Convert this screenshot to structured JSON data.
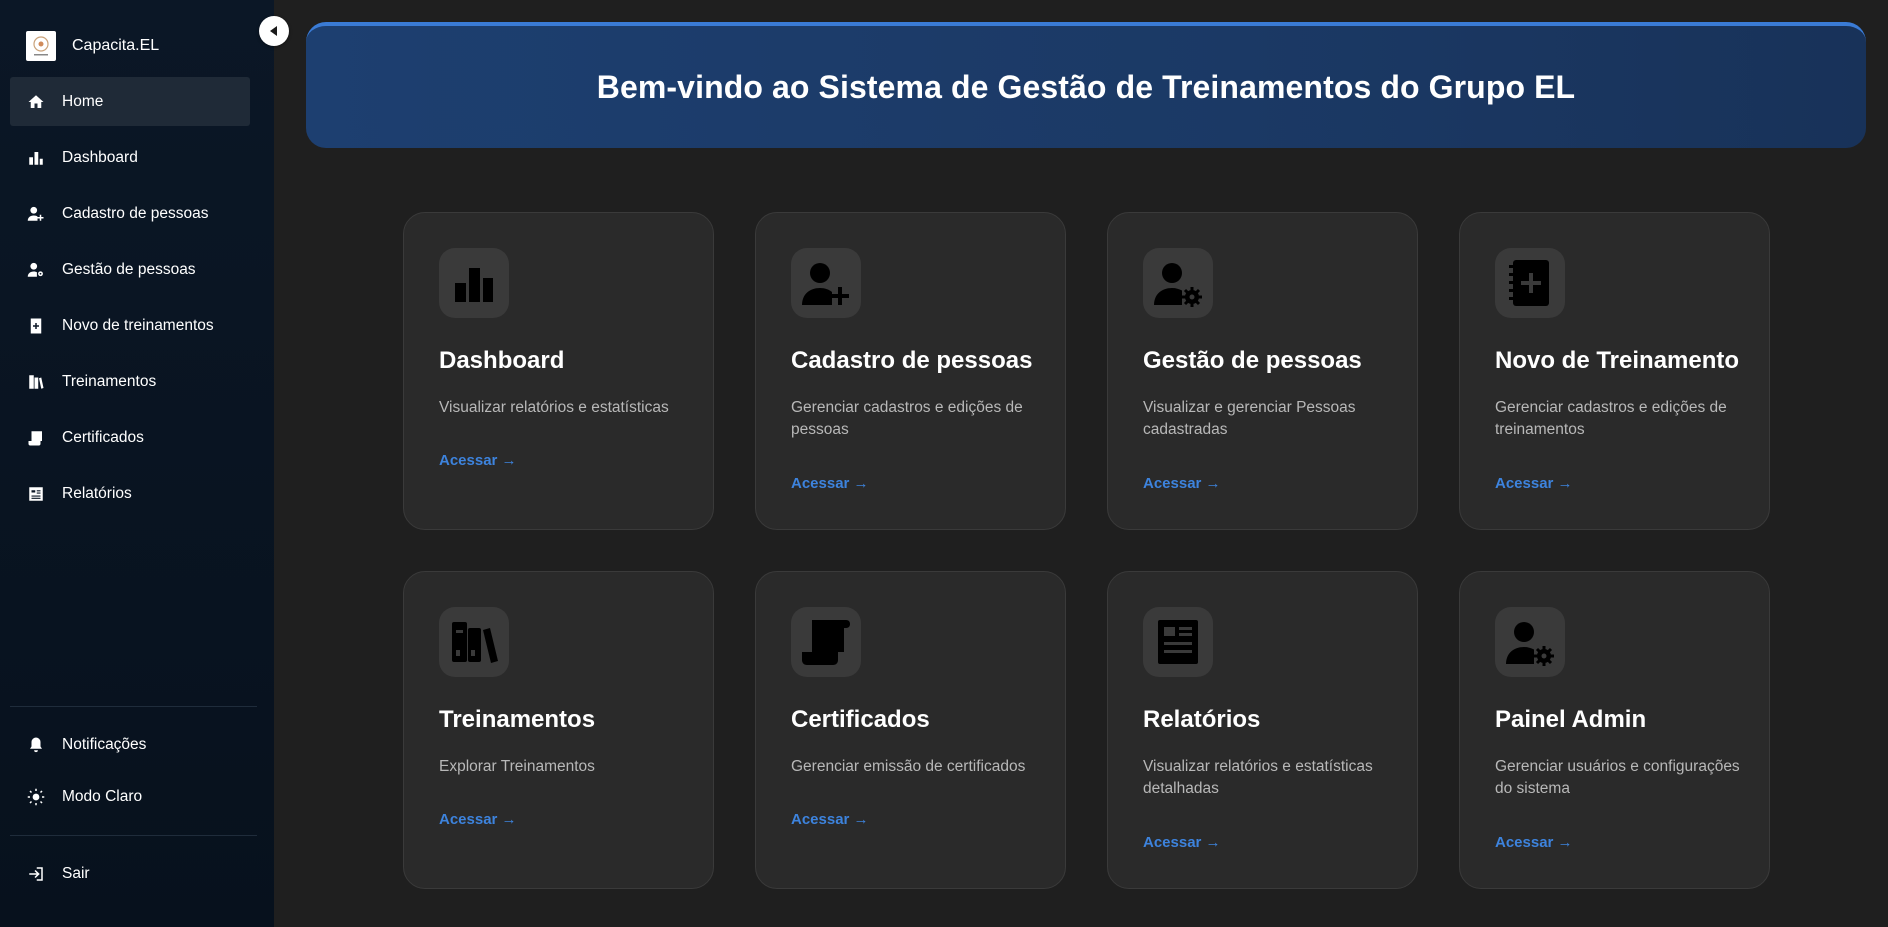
{
  "app": {
    "name": "Capacita.EL"
  },
  "sidebar": {
    "items": [
      {
        "label": "Home",
        "icon": "home-icon",
        "active": true
      },
      {
        "label": "Dashboard",
        "icon": "chart-icon"
      },
      {
        "label": "Cadastro de pessoas",
        "icon": "person-add-icon"
      },
      {
        "label": "Gestão de pessoas",
        "icon": "person-gear-icon"
      },
      {
        "label": "Novo de treinamentos",
        "icon": "notebook-plus-icon"
      },
      {
        "label": "Treinamentos",
        "icon": "books-icon"
      },
      {
        "label": "Certificados",
        "icon": "scroll-icon"
      },
      {
        "label": "Relatórios",
        "icon": "report-icon"
      }
    ],
    "notifications_label": "Notificações",
    "theme_label": "Modo Claro",
    "logout_label": "Sair"
  },
  "banner": {
    "title": "Bem-vindo ao Sistema de Gestão de Treinamentos do Grupo EL"
  },
  "cards": [
    {
      "title": "Dashboard",
      "desc": "Visualizar relatórios e estatísticas",
      "link": "Acessar →",
      "icon": "chart-icon"
    },
    {
      "title": "Cadastro de pessoas",
      "desc": "Gerenciar cadastros e edições de pessoas",
      "link": "Acessar →",
      "icon": "person-add-icon"
    },
    {
      "title": "Gestão de pessoas",
      "desc": "Visualizar e gerenciar Pessoas cadastradas",
      "link": "Acessar →",
      "icon": "person-gear-icon"
    },
    {
      "title": "Novo de Treinamento",
      "desc": "Gerenciar cadastros e edições de treinamentos",
      "link": "Acessar →",
      "icon": "notebook-plus-icon"
    },
    {
      "title": "Treinamentos",
      "desc": "Explorar Treinamentos",
      "link": "Acessar →",
      "icon": "books-icon"
    },
    {
      "title": "Certificados",
      "desc": "Gerenciar emissão de certificados",
      "link": "Acessar →",
      "icon": "scroll-icon"
    },
    {
      "title": "Relatórios",
      "desc": "Visualizar relatórios e estatísticas detalhadas",
      "link": "Acessar →",
      "icon": "report-icon"
    },
    {
      "title": "Painel Admin",
      "desc": "Gerenciar usuários e configurações do sistema",
      "link": "Acessar →",
      "icon": "person-gear-icon"
    }
  ],
  "colors": {
    "accent": "#3d83dd",
    "sidebar_bg": "#0b1726",
    "banner_bg": "#1d3f70",
    "card_bg": "#2a2a2a",
    "page_bg": "#1f1f1f"
  }
}
